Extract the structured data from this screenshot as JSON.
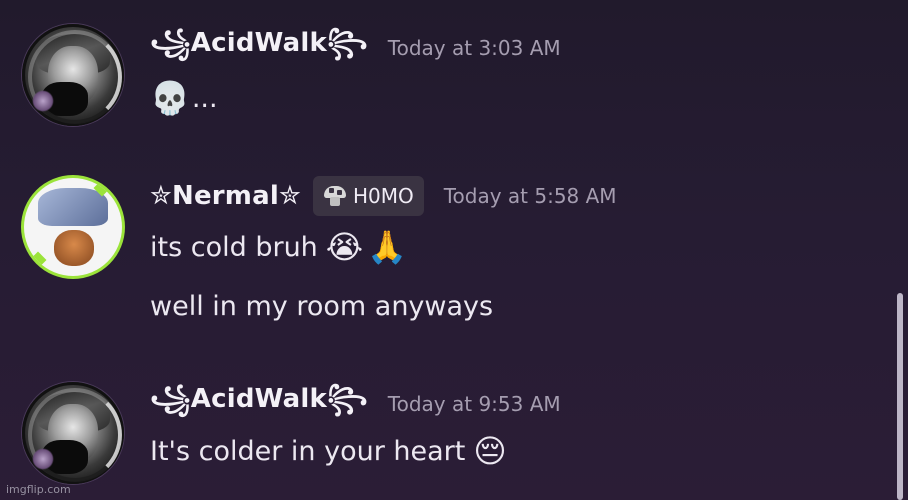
{
  "messages": [
    {
      "author": "꧁AcidWalk꧂",
      "timestamp": "Today at 3:03 AM",
      "lines": [
        {
          "emoji": "💀",
          "text": "..."
        }
      ]
    },
    {
      "author": "✮Nermal✮",
      "role_tag": "H0MO",
      "role_icon": "mushroom-icon",
      "timestamp": "Today at 5:58 AM",
      "lines": [
        {
          "text": "its cold bruh",
          "emoji_1": "😭",
          "emoji_2": "🙏"
        },
        {
          "text": "well in my room anyways"
        }
      ]
    },
    {
      "author": "꧁AcidWalk꧂",
      "timestamp": "Today at 9:53 AM",
      "lines": [
        {
          "text": "It's colder in your heart",
          "emoji": "😔"
        }
      ]
    }
  ],
  "watermark": "imgflip.com",
  "colors": {
    "background_top": "#211a2c",
    "background_bottom": "#2b1d36",
    "username": "#f4f1f7",
    "timestamp": "#a59db0",
    "message_text": "#ece8f1",
    "role_tag_bg": "#3a3342",
    "nermal_avatar_ring": "#9be33a",
    "scrollbar_thumb": "#bdb6c7"
  }
}
